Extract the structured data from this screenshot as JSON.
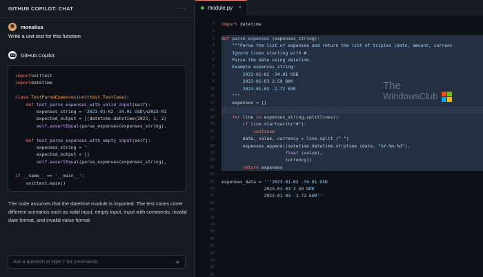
{
  "chat": {
    "title": "GITHUB COPILOT: CHAT",
    "more_icon": "ellipsis-icon",
    "user": {
      "name": "monalisa",
      "message": "Write a unit test for this function"
    },
    "bot": {
      "name": "GitHub Copilot"
    },
    "code_lines": [
      [
        [
          "kw",
          "import"
        ],
        [
          "",
          "unittest"
        ]
      ],
      [
        [
          "kw",
          "import"
        ],
        [
          "",
          "datetime"
        ]
      ],
      [],
      [
        [
          "kw",
          "class"
        ],
        [
          "",
          " "
        ],
        [
          "cls",
          "TestParseExpences"
        ],
        [
          "",
          "("
        ],
        [
          "cls",
          "unittest.TestCase"
        ],
        [
          "",
          "):"
        ]
      ],
      [
        [
          "",
          "    "
        ],
        [
          "kw",
          "def"
        ],
        [
          "",
          " "
        ],
        [
          "fn",
          "test_parse_expenses_with_valid_input"
        ],
        [
          "",
          "(self):"
        ]
      ],
      [
        [
          "",
          "        expenses_string = "
        ],
        [
          "str",
          "'2023-01-02 -34.01 USD\\n2023-01"
        ]
      ],
      [
        [
          "",
          "        expected_output = [(datetime.datetime(2023, 1, 2)"
        ]
      ],
      [
        [
          "",
          "        "
        ],
        [
          "fn",
          "self.assertEqual"
        ],
        [
          "",
          "(parse_expenses(expenses_string),"
        ]
      ],
      [],
      [
        [
          "",
          "    "
        ],
        [
          "kw",
          "def"
        ],
        [
          "",
          " "
        ],
        [
          "fn",
          "test_parse_expenses_with_empty_input"
        ],
        [
          "",
          "(self):"
        ]
      ],
      [
        [
          "",
          "        expenses_string = "
        ],
        [
          "str",
          "''"
        ]
      ],
      [
        [
          "",
          "        expected_output = []"
        ]
      ],
      [
        [
          "",
          "        "
        ],
        [
          "fn",
          "self.assertEqual"
        ],
        [
          "",
          "(parse_expenses(expenses_string),"
        ]
      ],
      [],
      [
        [
          "kw",
          "if"
        ],
        [
          "",
          " __name__ == "
        ],
        [
          "str",
          "'__main__'"
        ],
        [
          "",
          ":"
        ]
      ],
      [
        [
          "",
          "    unittest.main()"
        ]
      ]
    ],
    "explanation": "The code assumes that the datetime module is imported. The test cases cover different scenarios such as valid input, empty input, input with comments, invalid date format, and invalid value format.",
    "input_placeholder": "Ask a question or type '/' for commands",
    "send_icon": "send-icon"
  },
  "editor": {
    "tab_label": "module.py",
    "tab_close": "×",
    "line_numbers": [
      "1",
      "2",
      "3",
      "4",
      "5",
      "6",
      "7",
      "8",
      "9",
      "10",
      "11",
      "12",
      "13",
      "14",
      "15",
      "16",
      "17",
      "18",
      "19",
      "20",
      "21",
      "22",
      "23",
      "24",
      "25",
      "26",
      "27",
      "28",
      "29",
      "30",
      "31",
      "32",
      "33",
      "34",
      "35",
      "36"
    ],
    "code_lines": [
      {
        "hl": false,
        "t": [
          [
            "kw",
            "import"
          ],
          [
            "",
            " datetime"
          ]
        ]
      },
      {
        "hl": false,
        "t": []
      },
      {
        "hl": true,
        "t": [
          [
            "kw",
            "def"
          ],
          [
            "",
            " "
          ],
          [
            "fn",
            "parse_expenses"
          ],
          [
            "",
            " (expenses_string):"
          ]
        ]
      },
      {
        "hl": true,
        "t": [
          [
            "",
            "    "
          ],
          [
            "str",
            "\"\"\"Parse the list of expenses and return the list of triples (date, amount, currenc"
          ]
        ]
      },
      {
        "hl": true,
        "t": [
          [
            "",
            "    "
          ],
          [
            "str",
            "Ignore lines starting with #."
          ]
        ]
      },
      {
        "hl": true,
        "t": [
          [
            "",
            "    "
          ],
          [
            "str",
            "Parse the date using datetime."
          ]
        ]
      },
      {
        "hl": true,
        "t": [
          [
            "",
            "    "
          ],
          [
            "str",
            "Example expenses_string:"
          ]
        ]
      },
      {
        "hl": true,
        "t": [
          [
            "",
            "        "
          ],
          [
            "str",
            "2023-01-02 -34.01 USD"
          ]
        ]
      },
      {
        "hl": true,
        "t": [
          [
            "",
            "        "
          ],
          [
            "str",
            "2023-01-03 2.59 DKK"
          ]
        ]
      },
      {
        "hl": true,
        "t": [
          [
            "",
            "        "
          ],
          [
            "str",
            "2023-01-03 -2.72 EUR"
          ]
        ]
      },
      {
        "hl": true,
        "t": [
          [
            "",
            "    "
          ],
          [
            "str",
            "\"\"\""
          ]
        ]
      },
      {
        "hl": true,
        "t": [
          [
            "",
            "    expenses = []"
          ]
        ]
      },
      {
        "hl": true,
        "cur": true,
        "t": [
          [
            "",
            ""
          ]
        ]
      },
      {
        "hl": true,
        "t": [
          [
            "",
            "    "
          ],
          [
            "kw",
            "for"
          ],
          [
            "",
            " line "
          ],
          [
            "kw",
            "in"
          ],
          [
            "",
            " expenses_string.splitlines():"
          ]
        ]
      },
      {
        "hl": true,
        "t": [
          [
            "",
            "        "
          ],
          [
            "kw",
            "if"
          ],
          [
            "",
            " line.startswith("
          ],
          [
            "str",
            "\"#\""
          ],
          [
            "",
            "):"
          ]
        ]
      },
      {
        "hl": true,
        "t": [
          [
            "",
            "            "
          ],
          [
            "kw",
            "continue"
          ]
        ]
      },
      {
        "hl": true,
        "t": [
          [
            "",
            "        date, value, currency = line.split ("
          ],
          [
            "str",
            "\" \""
          ],
          [
            "",
            ")"
          ]
        ]
      },
      {
        "hl": true,
        "t": [
          [
            "",
            "        expenses.append((datetime.datetime.strptime (date, "
          ],
          [
            "str",
            "\"%Y-%m-%d\""
          ],
          [
            "",
            "),"
          ]
        ]
      },
      {
        "hl": true,
        "t": [
          [
            "",
            "                        "
          ],
          [
            "fn",
            "float"
          ],
          [
            "",
            " (value),"
          ]
        ]
      },
      {
        "hl": true,
        "t": [
          [
            "",
            "                        currency))"
          ]
        ]
      },
      {
        "hl": true,
        "t": [
          [
            "",
            "        "
          ],
          [
            "kw",
            "return"
          ],
          [
            "",
            " expenses"
          ]
        ]
      },
      {
        "hl": false,
        "t": []
      },
      {
        "hl": false,
        "t": [
          [
            "",
            "expenses_data = "
          ],
          [
            "str",
            "'''2023-01-02 -34.01 USD"
          ]
        ]
      },
      {
        "hl": false,
        "t": [
          [
            "",
            "                "
          ],
          [
            "str",
            "2023-01-03 2.59 DKK"
          ]
        ]
      },
      {
        "hl": false,
        "t": [
          [
            "",
            "                "
          ],
          [
            "str",
            "2023-01-03 -2.72 EUR'''"
          ]
        ]
      }
    ]
  },
  "watermark": {
    "line1": "The",
    "line2": "WindowsClub",
    "logo_colors": [
      "#f25022",
      "#7fba00",
      "#00a4ef",
      "#ffb900"
    ]
  }
}
